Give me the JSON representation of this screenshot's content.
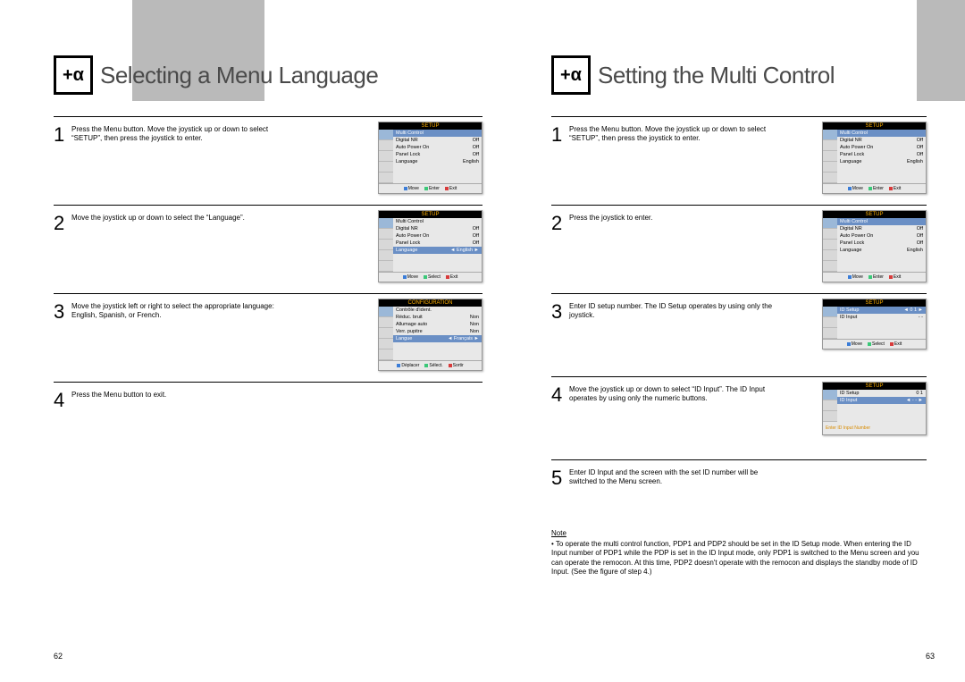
{
  "alpha_symbol": "+α",
  "left": {
    "title": "Selecting a Menu Language",
    "steps": [
      {
        "num": "1",
        "text": "Press the Menu button. Move the joystick up or down to select “SETUP”, then press the joystick to enter."
      },
      {
        "num": "2",
        "text": "Move the joystick up or down to select the “Language”."
      },
      {
        "num": "3",
        "text": "Move the joystick left or right to select the appropriate language: English, Spanish, or French."
      },
      {
        "num": "4",
        "text": "Press the Menu button to exit."
      }
    ],
    "page_num": "62"
  },
  "right": {
    "title": "Setting the Multi Control",
    "steps": [
      {
        "num": "1",
        "text": "Press the Menu button. Move the joystick up or down to select “SETUP”, then press the joystick to enter."
      },
      {
        "num": "2",
        "text": "Press the joystick to enter."
      },
      {
        "num": "3",
        "text": "Enter ID setup number. The ID Setup operates by using only the joystick."
      },
      {
        "num": "4",
        "text": "Move the joystick up or down to select “ID Input”. The ID Input operates by using only the numeric buttons."
      },
      {
        "num": "5",
        "text": "Enter ID Input and the screen with the set ID number will be switched to the Menu screen."
      }
    ],
    "note_title": "Note",
    "note_body": "• To operate the multi control function, PDP1 and PDP2 should be set in the ID Setup mode. When entering the ID Input number of PDP1 while the PDP is set in the ID Input mode, only PDP1 is switched to the Menu screen and you can operate the remocon. At this time, PDP2 doesn't operate with the remocon and displays the standby mode of ID Input. (See the figure of step 4.)",
    "page_num": "63"
  },
  "osd": {
    "setup_title": "SETUP",
    "config_title": "CONFIGURATION",
    "rows_setup": [
      {
        "k": "Multi Control",
        "v": ""
      },
      {
        "k": "Digital NR",
        "v": "Off"
      },
      {
        "k": "Auto Power On",
        "v": "Off"
      },
      {
        "k": "Panel Lock",
        "v": "Off"
      },
      {
        "k": "Language",
        "v": "English"
      }
    ],
    "rows_setup_lang_hl": [
      {
        "k": "Multi Control",
        "v": ""
      },
      {
        "k": "Digital NR",
        "v": "Off"
      },
      {
        "k": "Auto Power On",
        "v": "Off"
      },
      {
        "k": "Panel Lock",
        "v": "Off"
      },
      {
        "k": "Language",
        "v": "◄ English ►",
        "hl": true
      }
    ],
    "rows_config": [
      {
        "k": "Contrôle d'ident.",
        "v": ""
      },
      {
        "k": "Réduc. bruit",
        "v": "Non"
      },
      {
        "k": "Allumage auto",
        "v": "Non"
      },
      {
        "k": "Verr. pupitre",
        "v": "Non"
      },
      {
        "k": "Langue",
        "v": "◄ Français ►",
        "hl": true
      }
    ],
    "rows_multi_hl": [
      {
        "k": "Multi Control",
        "v": "",
        "hl": true
      },
      {
        "k": "Digital NR",
        "v": "Off"
      },
      {
        "k": "Auto Power On",
        "v": "Off"
      },
      {
        "k": "Panel Lock",
        "v": "Off"
      },
      {
        "k": "Language",
        "v": "English"
      }
    ],
    "rows_id_setup": [
      {
        "k": "ID Setup",
        "v": "◄ 0 1 ►",
        "hl": true
      },
      {
        "k": "ID Input",
        "v": "- -"
      }
    ],
    "rows_id_input": [
      {
        "k": "ID Setup",
        "v": "0 1"
      },
      {
        "k": "ID Input",
        "v": "◄ - - ►",
        "hl": true
      }
    ],
    "foot_move": "Move",
    "foot_enter": "Enter",
    "foot_exit": "Exit",
    "foot_select": "Select",
    "foot_deplacer": "Déplacer",
    "foot_selectfr": "Sélect.",
    "foot_sortir": "Sortir",
    "id_msg": "Enter ID Input Number"
  }
}
